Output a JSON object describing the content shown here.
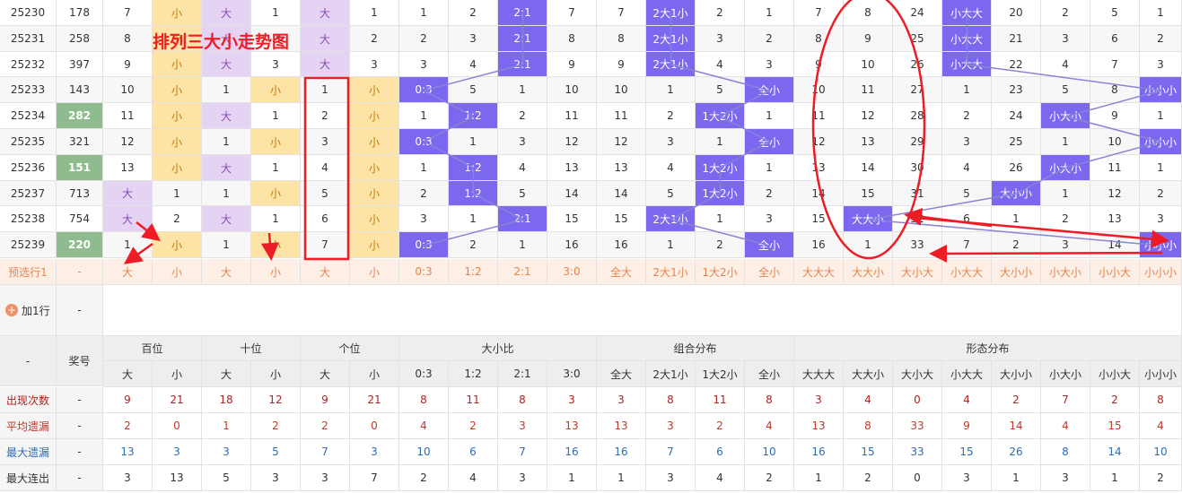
{
  "chart_title_overlay": "排列三大小走势图",
  "labels": {
    "preview_row": "预选行1",
    "add_row": "加1行",
    "dash": "-",
    "award_header": "奖号"
  },
  "groups": [
    {
      "name": "百位",
      "subs": [
        "大",
        "小"
      ]
    },
    {
      "name": "十位",
      "subs": [
        "大",
        "小"
      ]
    },
    {
      "name": "个位",
      "subs": [
        "大",
        "小"
      ]
    },
    {
      "name": "大小比",
      "subs": [
        "0:3",
        "1:2",
        "2:1",
        "3:0"
      ]
    },
    {
      "name": "组合分布",
      "subs": [
        "全大",
        "2大1小",
        "1大2小",
        "全小"
      ]
    },
    {
      "name": "形态分布",
      "subs": [
        "大大大",
        "大大小",
        "大小大",
        "小大大",
        "大小小",
        "小大小",
        "小小大",
        "小小小"
      ]
    }
  ],
  "rows": [
    {
      "issue": "25230",
      "num": "178",
      "cells": [
        "7",
        "小",
        "大",
        "1",
        "大",
        "1",
        "1",
        "2",
        "2:1",
        "7",
        "7",
        "2大1小",
        "2",
        "1",
        "7",
        "8",
        "24",
        "小大大",
        "20",
        "2",
        "5",
        "1"
      ]
    },
    {
      "issue": "25231",
      "num": "258",
      "cells": [
        "8",
        "小",
        "大",
        "2",
        "大",
        "2",
        "2",
        "3",
        "2:1",
        "8",
        "8",
        "2大1小",
        "3",
        "2",
        "8",
        "9",
        "25",
        "小大大",
        "21",
        "3",
        "6",
        "2"
      ]
    },
    {
      "issue": "25232",
      "num": "397",
      "cells": [
        "9",
        "小",
        "大",
        "3",
        "大",
        "3",
        "3",
        "4",
        "2:1",
        "9",
        "9",
        "2大1小",
        "4",
        "3",
        "9",
        "10",
        "26",
        "小大大",
        "22",
        "4",
        "7",
        "3"
      ]
    },
    {
      "issue": "25233",
      "num": "143",
      "cells": [
        "10",
        "小",
        "1",
        "小",
        "1",
        "小",
        "0:3",
        "5",
        "1",
        "10",
        "10",
        "1",
        "5",
        "全小",
        "10",
        "11",
        "27",
        "1",
        "23",
        "5",
        "8",
        "小小小"
      ]
    },
    {
      "issue": "25234",
      "num": "282",
      "cells": [
        "11",
        "小",
        "大",
        "1",
        "2",
        "小",
        "1",
        "1:2",
        "2",
        "11",
        "11",
        "2",
        "1大2小",
        "1",
        "11",
        "12",
        "28",
        "2",
        "24",
        "小大小",
        "9",
        "1"
      ]
    },
    {
      "issue": "25235",
      "num": "321",
      "cells": [
        "12",
        "小",
        "1",
        "小",
        "3",
        "小",
        "0:3",
        "1",
        "3",
        "12",
        "12",
        "3",
        "1",
        "全小",
        "12",
        "13",
        "29",
        "3",
        "25",
        "1",
        "10",
        "小小小"
      ]
    },
    {
      "issue": "25236",
      "num": "151",
      "cells": [
        "13",
        "小",
        "大",
        "1",
        "4",
        "小",
        "1",
        "1:2",
        "4",
        "13",
        "13",
        "4",
        "1大2小",
        "1",
        "13",
        "14",
        "30",
        "4",
        "26",
        "小大小",
        "11",
        "1"
      ]
    },
    {
      "issue": "25237",
      "num": "713",
      "cells": [
        "大",
        "1",
        "1",
        "小",
        "5",
        "小",
        "2",
        "1:2",
        "5",
        "14",
        "14",
        "5",
        "1大2小",
        "2",
        "14",
        "15",
        "31",
        "5",
        "大小小",
        "1",
        "12",
        "2"
      ]
    },
    {
      "issue": "25238",
      "num": "754",
      "cells": [
        "大",
        "2",
        "大",
        "1",
        "6",
        "小",
        "3",
        "1",
        "2:1",
        "15",
        "15",
        "2大1小",
        "1",
        "3",
        "15",
        "大大小",
        "32",
        "6",
        "1",
        "2",
        "13",
        "3"
      ]
    },
    {
      "issue": "25239",
      "num": "220",
      "cells": [
        "1",
        "小",
        "1",
        "小",
        "7",
        "小",
        "0:3",
        "2",
        "1",
        "16",
        "16",
        "1",
        "2",
        "全小",
        "16",
        "1",
        "33",
        "7",
        "2",
        "3",
        "14",
        "小小小"
      ]
    }
  ],
  "preview_cells": [
    "大",
    "小",
    "大",
    "小",
    "大",
    "小",
    "0:3",
    "1:2",
    "2:1",
    "3:0",
    "全大",
    "2大1小",
    "1大2小",
    "全小",
    "大大大",
    "大大小",
    "大小大",
    "小大大",
    "大小小",
    "小大小",
    "小小大",
    "小小小"
  ],
  "stats": [
    {
      "label": "出现次数",
      "kind": "count",
      "vals": [
        "9",
        "21",
        "18",
        "12",
        "9",
        "21",
        "8",
        "11",
        "8",
        "3",
        "3",
        "8",
        "11",
        "8",
        "3",
        "4",
        "0",
        "4",
        "2",
        "7",
        "2",
        "8"
      ]
    },
    {
      "label": "平均遗漏",
      "kind": "avg",
      "vals": [
        "2",
        "0",
        "1",
        "2",
        "2",
        "0",
        "4",
        "2",
        "3",
        "13",
        "13",
        "3",
        "2",
        "4",
        "13",
        "8",
        "33",
        "9",
        "14",
        "4",
        "15",
        "4"
      ]
    },
    {
      "label": "最大遗漏",
      "kind": "maxmiss",
      "vals": [
        "13",
        "3",
        "3",
        "5",
        "7",
        "3",
        "10",
        "6",
        "7",
        "16",
        "16",
        "7",
        "6",
        "10",
        "16",
        "15",
        "33",
        "15",
        "26",
        "8",
        "14",
        "10"
      ]
    },
    {
      "label": "最大连出",
      "kind": "maxrun",
      "vals": [
        "3",
        "13",
        "5",
        "3",
        "3",
        "7",
        "2",
        "4",
        "3",
        "1",
        "1",
        "3",
        "4",
        "2",
        "1",
        "2",
        "0",
        "3",
        "1",
        "3",
        "1",
        "2"
      ]
    }
  ],
  "colors": {
    "highlight": "#7b68ee",
    "big": "#e4d3f3",
    "small": "#fde3a6",
    "green_award": "#8fbc8f",
    "red": "#ee1c25",
    "count": "#b22222",
    "avg": "#c0392b",
    "maxmiss": "#2e6db4",
    "maxrun": "#333333"
  }
}
